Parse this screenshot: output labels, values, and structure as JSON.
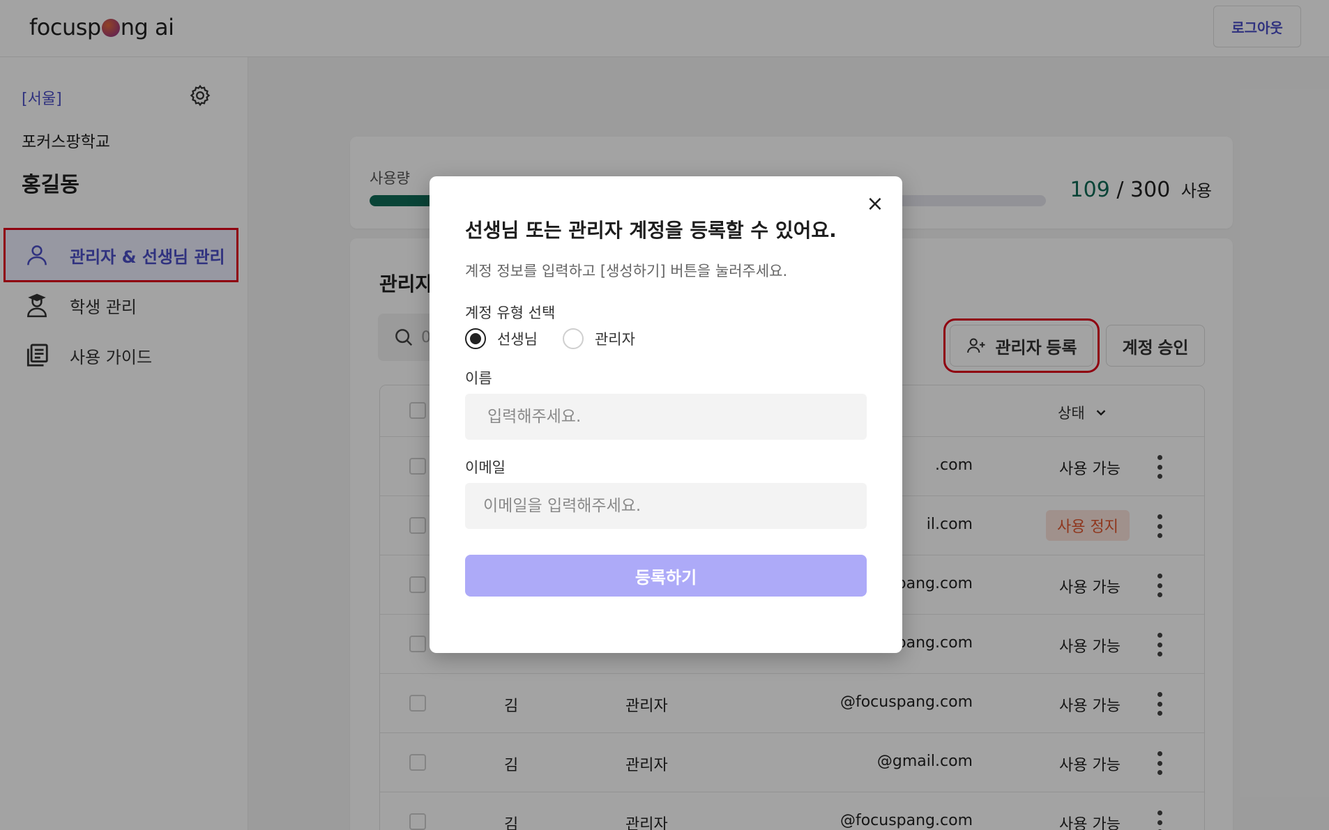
{
  "header": {
    "logo_text_1": "focusp",
    "logo_text_2": "ng ai",
    "logout_label": "로그아웃"
  },
  "sidebar": {
    "region": "[서울]",
    "school": "포커스팡학교",
    "user_name": "홍길동",
    "items": [
      {
        "label": "관리자 & 선생님 관리",
        "icon": "user-icon",
        "active": true
      },
      {
        "label": "학생 관리",
        "icon": "student-icon",
        "active": false
      },
      {
        "label": "사용 가이드",
        "icon": "guide-icon",
        "active": false
      }
    ]
  },
  "usage": {
    "label": "사용량",
    "used": "109",
    "separator": "/",
    "total": "300",
    "unit": "사용",
    "fraction": 0.363
  },
  "list": {
    "title": "관리자",
    "search_placeholder": "0",
    "register_button": "관리자 등록",
    "approve_button": "계정 승인",
    "status_header": "상태",
    "rows": [
      {
        "name": "",
        "role": "",
        "email": ".com",
        "status": "사용 가능",
        "stopped": false
      },
      {
        "name": "",
        "role": "",
        "email": "il.com",
        "status": "사용 정지",
        "stopped": true
      },
      {
        "name": "",
        "role": "",
        "email": "pang.com",
        "status": "사용 가능",
        "stopped": false
      },
      {
        "name": "",
        "role": "",
        "email": "spang.com",
        "status": "사용 가능",
        "stopped": false
      },
      {
        "name": "김",
        "role": "관리자",
        "email": "@focuspang.com",
        "status": "사용 가능",
        "stopped": false
      },
      {
        "name": "김",
        "role": "관리자",
        "email": "@gmail.com",
        "status": "사용 가능",
        "stopped": false
      },
      {
        "name": "김",
        "role": "관리자",
        "email": "@focuspang.com",
        "status": "사용 가능",
        "stopped": false
      }
    ]
  },
  "modal": {
    "close_symbol": "×",
    "title": "선생님 또는 관리자 계정을 등록할 수 있어요.",
    "description": "계정 정보를 입력하고 [생성하기] 버튼을 눌러주세요.",
    "type_label": "계정 유형 선택",
    "type_options": [
      {
        "label": "선생님",
        "checked": true
      },
      {
        "label": "관리자",
        "checked": false
      }
    ],
    "name_label": "이름",
    "name_placeholder": "입력해주세요.",
    "email_label": "이메일",
    "email_placeholder": "이메일을 입력해주세요.",
    "submit_label": "등록하기"
  },
  "colors": {
    "accent": "#4b4fc7",
    "usage_fill": "#0f6b56",
    "submit_disabled": "#adaaf8",
    "stop_badge_bg": "#fbe3dc",
    "stop_badge_text": "#e0572f",
    "highlight_box": "#e0001a"
  }
}
